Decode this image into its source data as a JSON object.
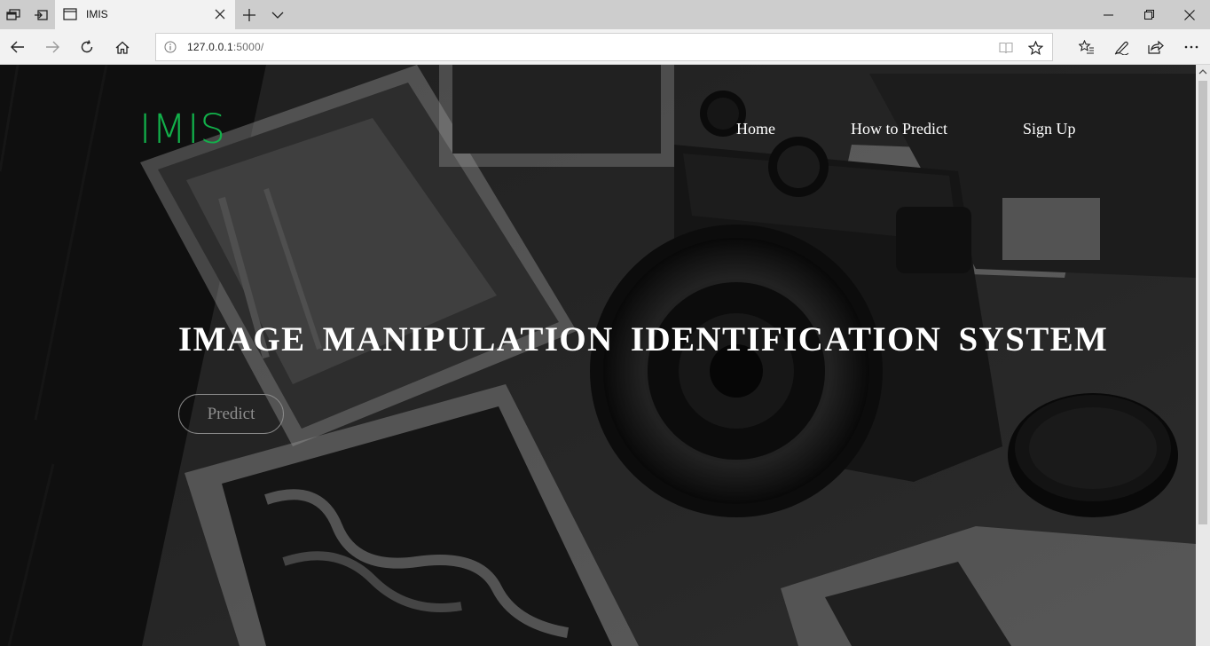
{
  "browser": {
    "tab_title": "IMIS",
    "address": {
      "host": "127.0.0.1",
      "rest": ":5000/"
    },
    "icons": [
      "tab-manager-icon",
      "set-aside-tabs-icon",
      "page-icon",
      "close-icon",
      "new-tab-icon",
      "tab-list-chevron-icon",
      "minimize-icon",
      "restore-icon",
      "window-close-icon",
      "back-icon",
      "forward-icon",
      "refresh-icon",
      "home-icon",
      "info-icon",
      "reading-view-icon",
      "favorite-star-icon",
      "favorites-list-icon",
      "pen-icon",
      "share-icon",
      "more-icon"
    ]
  },
  "site": {
    "logo": "IMIS",
    "nav": {
      "home": "Home",
      "how_to": "How to Predict",
      "signup": "Sign Up"
    },
    "hero_title": "IMAGE MANIPULATION IDENTIFICATION SYSTEM",
    "predict_button": "Predict",
    "colors": {
      "logo": "#12b04a",
      "text": "#ffffff",
      "button_text": "#8e8e8e"
    }
  }
}
